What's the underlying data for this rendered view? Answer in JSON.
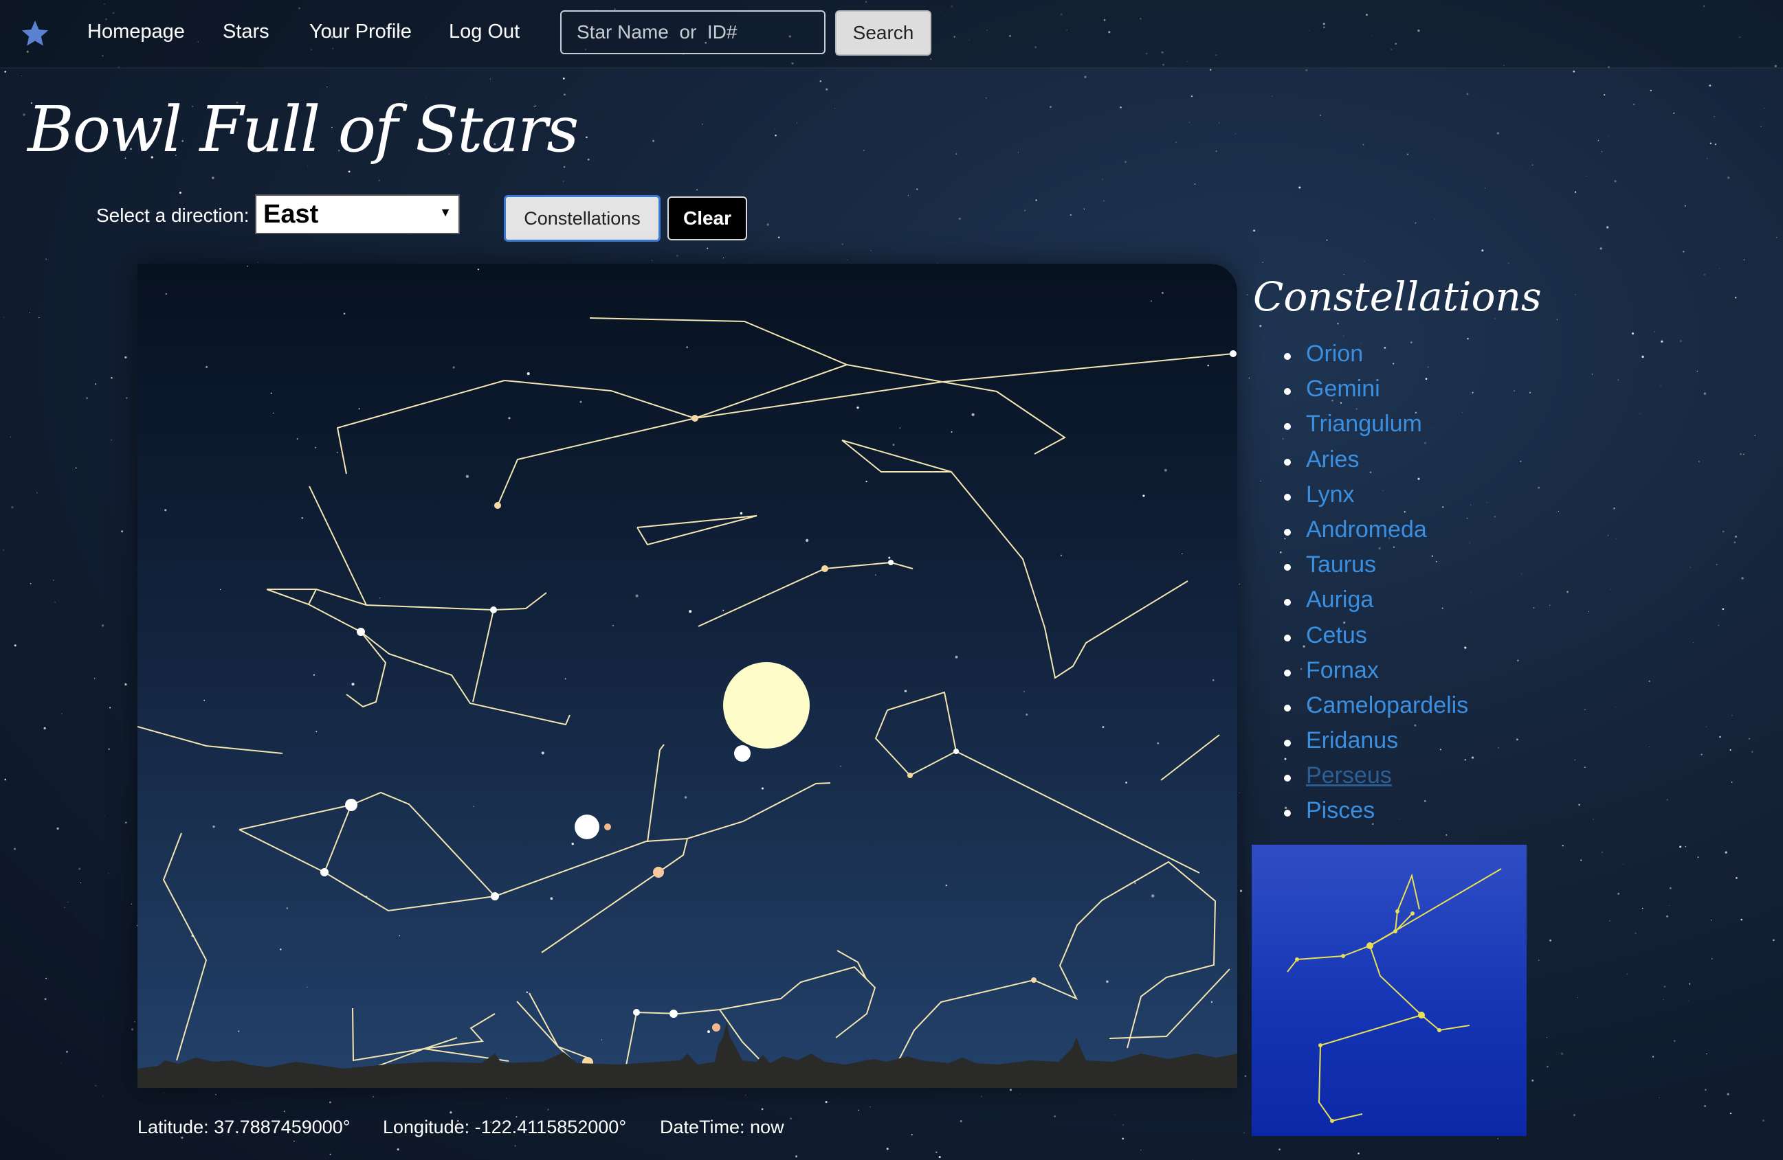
{
  "nav": {
    "brand_icon": "star-icon",
    "links": [
      "Homepage",
      "Stars",
      "Your Profile",
      "Log Out"
    ],
    "search_placeholder": "Star Name  or  ID#",
    "search_button": "Search"
  },
  "title": "Bowl Full of Stars",
  "controls": {
    "direction_label": "Select a direction:",
    "direction_value": "East",
    "constellations_button": "Constellations",
    "clear_button": "Clear"
  },
  "sidebar": {
    "heading": "Constellations",
    "items": [
      "Orion",
      "Gemini",
      "Triangulum",
      "Aries",
      "Lynx",
      "Andromeda",
      "Taurus",
      "Auriga",
      "Cetus",
      "Fornax",
      "Camelopardelis",
      "Eridanus",
      "Perseus",
      "Pisces"
    ],
    "visited_item": "Perseus",
    "preview_constellation": "Perseus"
  },
  "location": {
    "latitude": "Latitude: 37.7887459000°",
    "longitude": "Longitude: -122.4115852000°",
    "datetime": "DateTime: now"
  },
  "colors": {
    "link": "#3b8fe0",
    "constellation_line": "#f3e6b2",
    "preview_bg": "#1535b5",
    "sky_top": "#071120",
    "sky_bottom": "#213e66"
  }
}
